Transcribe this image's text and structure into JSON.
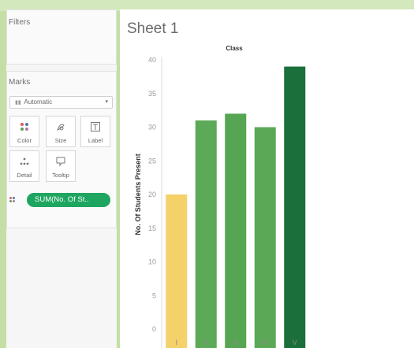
{
  "left_panel": {
    "filters": {
      "title": "Filters"
    },
    "marks": {
      "title": "Marks",
      "mark_type": "Automatic",
      "buttons": [
        {
          "label": "Color",
          "icon": "color-icon"
        },
        {
          "label": "Size",
          "icon": "size-icon"
        },
        {
          "label": "Label",
          "icon": "label-icon"
        },
        {
          "label": "Detail",
          "icon": "detail-icon"
        },
        {
          "label": "Tooltip",
          "icon": "tooltip-icon"
        }
      ],
      "pill": "SUM(No. Of St.."
    }
  },
  "sheet": {
    "title": "Sheet 1"
  },
  "colors": {
    "pill": "#1ea660",
    "bar_colors": [
      "#f5d16a",
      "#5ca957",
      "#56a552",
      "#5ba856",
      "#1a6f3a"
    ]
  },
  "chart_data": {
    "type": "bar",
    "title": "Class",
    "categories": [
      "I",
      "II",
      "III",
      "IV",
      "V"
    ],
    "values": [
      20,
      31,
      32,
      30,
      39
    ],
    "ylabel": "No. Of Students Present",
    "xlabel": "",
    "ylim": [
      0,
      40
    ],
    "yticks": [
      0,
      5,
      10,
      15,
      20,
      25,
      30,
      35,
      40
    ],
    "grid": false
  }
}
